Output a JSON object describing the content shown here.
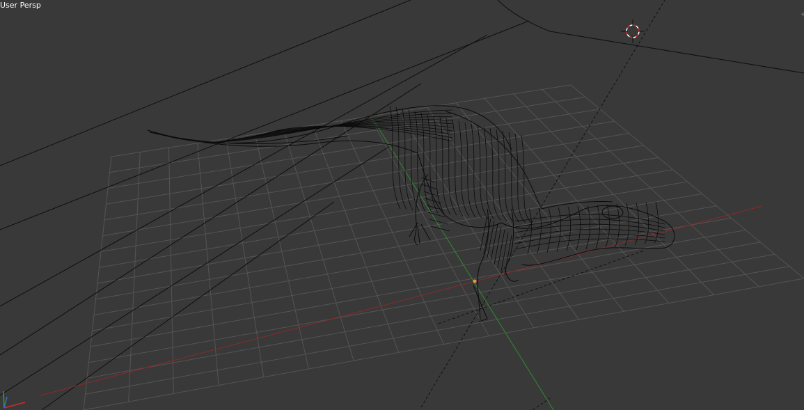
{
  "viewport": {
    "view_label": "User Persp",
    "shading": "wireframe",
    "background_color": "#393939",
    "grid_color": "#555555",
    "x_axis_color": "#8c2a2a",
    "y_axis_color": "#2f8c2f",
    "model_wire_color": "#0b0b0b",
    "cursor_icon": "3d-cursor-icon",
    "axis_gizmo_icon": "axis-gizmo-icon",
    "edge_handle_icon": "plus-icon"
  }
}
